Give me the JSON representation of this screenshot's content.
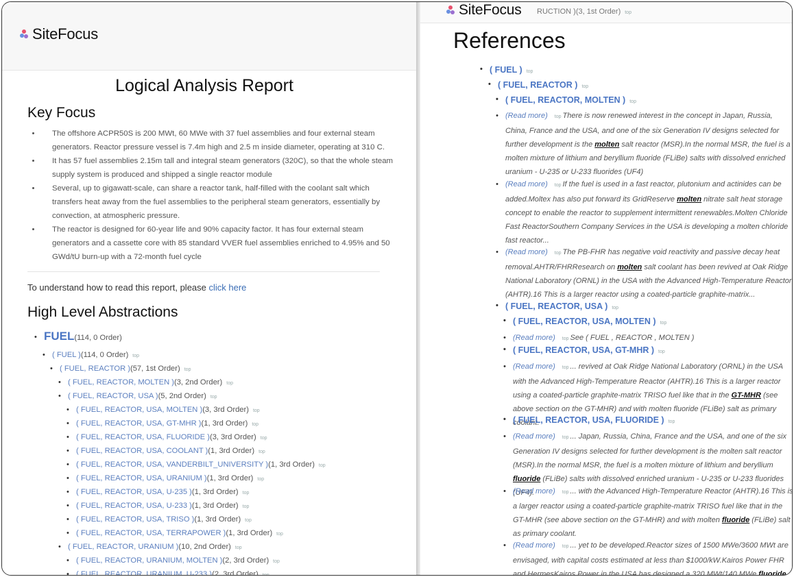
{
  "brand": {
    "name": "SiteFocus",
    "colors": {
      "dot1": "#e8506c",
      "dot2": "#6a8fe0",
      "dot3": "#9b6fd0",
      "link": "#4a75c3"
    }
  },
  "left": {
    "report_title": "Logical Analysis Report",
    "key_focus_heading": "Key Focus",
    "key_focus_items": [
      "The offshore ACPR50S is 200 MWt, 60 MWe with 37 fuel assemblies and four external steam generators. Reactor pressure vessel is 7.4m high and 2.5 m inside diameter, operating at 310 C.",
      "It has 57 fuel assemblies 2.15m tall and integral steam generators (320C), so that the whole steam supply system is produced and shipped a single reactor module",
      "Several, up to gigawatt-scale, can share a reactor tank, half-filled with the coolant salt which transfers heat away from the fuel assemblies to the peripheral steam generators, essentially by convection, at atmospheric pressure.",
      "The reactor is designed for 60-year life and 90% capacity factor. It has four external steam generators and a cassette core with 85 standard VVER fuel assemblies enriched to 4.95% and 50 GWd/tU burn-up with a 72-month fuel cycle"
    ],
    "howto_text": "To understand how to read this report, please ",
    "howto_link": "click here",
    "abstractions_heading": "High Level Abstractions",
    "tree": [
      {
        "label": "FUEL",
        "info": "(114, 0 Order)",
        "top": ""
      },
      {
        "label": "( FUEL )",
        "info": "(114, 0 Order)",
        "top": "top"
      },
      {
        "label": "( FUEL, REACTOR )",
        "info": "(57, 1st Order)",
        "top": "top"
      },
      {
        "label": "( FUEL, REACTOR, MOLTEN )",
        "info": "(3, 2nd Order)",
        "top": "top"
      },
      {
        "label": "( FUEL, REACTOR, USA )",
        "info": "(5, 2nd Order)",
        "top": "top"
      },
      {
        "label": "( FUEL, REACTOR, USA, MOLTEN )",
        "info": "(3, 3rd Order)",
        "top": "top"
      },
      {
        "label": "( FUEL, REACTOR, USA, GT-MHR )",
        "info": "(1, 3rd Order)",
        "top": "top"
      },
      {
        "label": "( FUEL, REACTOR, USA, FLUORIDE )",
        "info": "(3, 3rd Order)",
        "top": "top"
      },
      {
        "label": "( FUEL, REACTOR, USA, COOLANT )",
        "info": "(1, 3rd Order)",
        "top": "top"
      },
      {
        "label": "( FUEL, REACTOR, USA, VANDERBILT_UNIVERSITY )",
        "info": "(1, 3rd Order)",
        "top": "top"
      },
      {
        "label": "( FUEL, REACTOR, USA, URANIUM )",
        "info": "(1, 3rd Order)",
        "top": "top"
      },
      {
        "label": "( FUEL, REACTOR, USA, U-235 )",
        "info": "(1, 3rd Order)",
        "top": "top"
      },
      {
        "label": "( FUEL, REACTOR, USA, U-233 )",
        "info": "(1, 3rd Order)",
        "top": "top"
      },
      {
        "label": "( FUEL, REACTOR, USA, TRISO )",
        "info": "(1, 3rd Order)",
        "top": "top"
      },
      {
        "label": "( FUEL, REACTOR, USA, TERRAPOWER )",
        "info": "(1, 3rd Order)",
        "top": "top"
      },
      {
        "label": "( FUEL, REACTOR, URANIUM )",
        "info": "(10, 2nd Order)",
        "top": "top"
      },
      {
        "label": "( FUEL, REACTOR, URANIUM, MOLTEN )",
        "info": "(2, 3rd Order)",
        "top": "top"
      },
      {
        "label": "( FUEL, REACTOR, URANIUM, U-233 )",
        "info": "(2, 3rd Order)",
        "top": "top"
      }
    ]
  },
  "right": {
    "crumb_tail": "RUCTION )(3, 1st Order)",
    "crumb_top": "top",
    "title": "References",
    "read_more": "(Read more)",
    "top_label": "top",
    "headings": [
      "( FUEL )",
      "( FUEL, REACTOR )",
      "( FUEL, REACTOR, MOLTEN )",
      "( FUEL, REACTOR, USA )",
      "( FUEL, REACTOR, USA, MOLTEN )",
      "( FUEL, REACTOR, USA, GT-MHR )",
      "( FUEL, REACTOR, USA, FLUORIDE )"
    ],
    "refs": [
      {
        "pre": "There is now renewed interest in the concept in Japan, Russia, China, France and the USA, and one of the six Generation IV designs selected for further development is the ",
        "kw": "molten",
        "post": " salt reactor (MSR).In the normal MSR, the fuel is a molten mixture of lithium and beryllium fluoride (FLiBe) salts with dissolved enriched uranium - U-235 or U-233 fluorides (UF4)"
      },
      {
        "pre": "If the fuel is used in a fast reactor, plutonium and actinides can be added.Moltex has also put forward its GridReserve ",
        "kw": "molten",
        "post": " nitrate salt heat storage concept to enable the reactor to supplement intermittent renewables.Molten Chloride Fast ReactorSouthern Company Services in the USA is developing a molten chloride fast reactor..."
      },
      {
        "pre": "The PB-FHR has negative void reactivity and passive decay heat removal.AHTR/FHRResearch on ",
        "kw": "molten",
        "post": " salt coolant has been revived at Oak Ridge National Laboratory (ORNL) in the USA with the Advanced High-Temperature Reactor (AHTR).16 This is a larger reactor using a coated-particle graphite-matrix..."
      },
      {
        "pre": "See ( FUEL , REACTOR , MOLTEN )",
        "kw": "",
        "post": ""
      },
      {
        "pre": "... revived at Oak Ridge National Laboratory (ORNL) in the USA with the Advanced High-Temperature Reactor (AHTR).16 This is a larger reactor using a coated-particle graphite-matrix TRISO fuel like that in the ",
        "kw": "GT-MHR",
        "post": " (see above section on the GT-MHR) and with molten fluoride (FLiBe) salt as primary coolant."
      },
      {
        "pre": "... Japan, Russia, China, France and the USA, and one of the six Generation IV designs selected for further development is the molten salt reactor (MSR).In the normal MSR, the fuel is a molten mixture of lithium and beryllium ",
        "kw": "fluoride",
        "post": " (FLiBe) salts with dissolved enriched uranium - U-235 or U-233 fluorides (UF4)."
      },
      {
        "pre": "... with the Advanced High-Temperature Reactor (AHTR).16 This is a larger reactor using a coated-particle graphite-matrix TRISO fuel like that in the GT-MHR (see above section on the GT-MHR) and with molten ",
        "kw": "fluoride",
        "post": " (FLiBe) salt as primary coolant."
      },
      {
        "pre": "... yet to be developed.Reactor sizes of 1500 MWe/3600 MWt are envisaged, with capital costs estimated at less than $1000/kW.Kairos Power FHR and HermesKairos Power in the USA has designed a 320 MWt/140 MWe ",
        "kw": "fluoride",
        "post": " (FLiBe) salt..."
      }
    ]
  }
}
